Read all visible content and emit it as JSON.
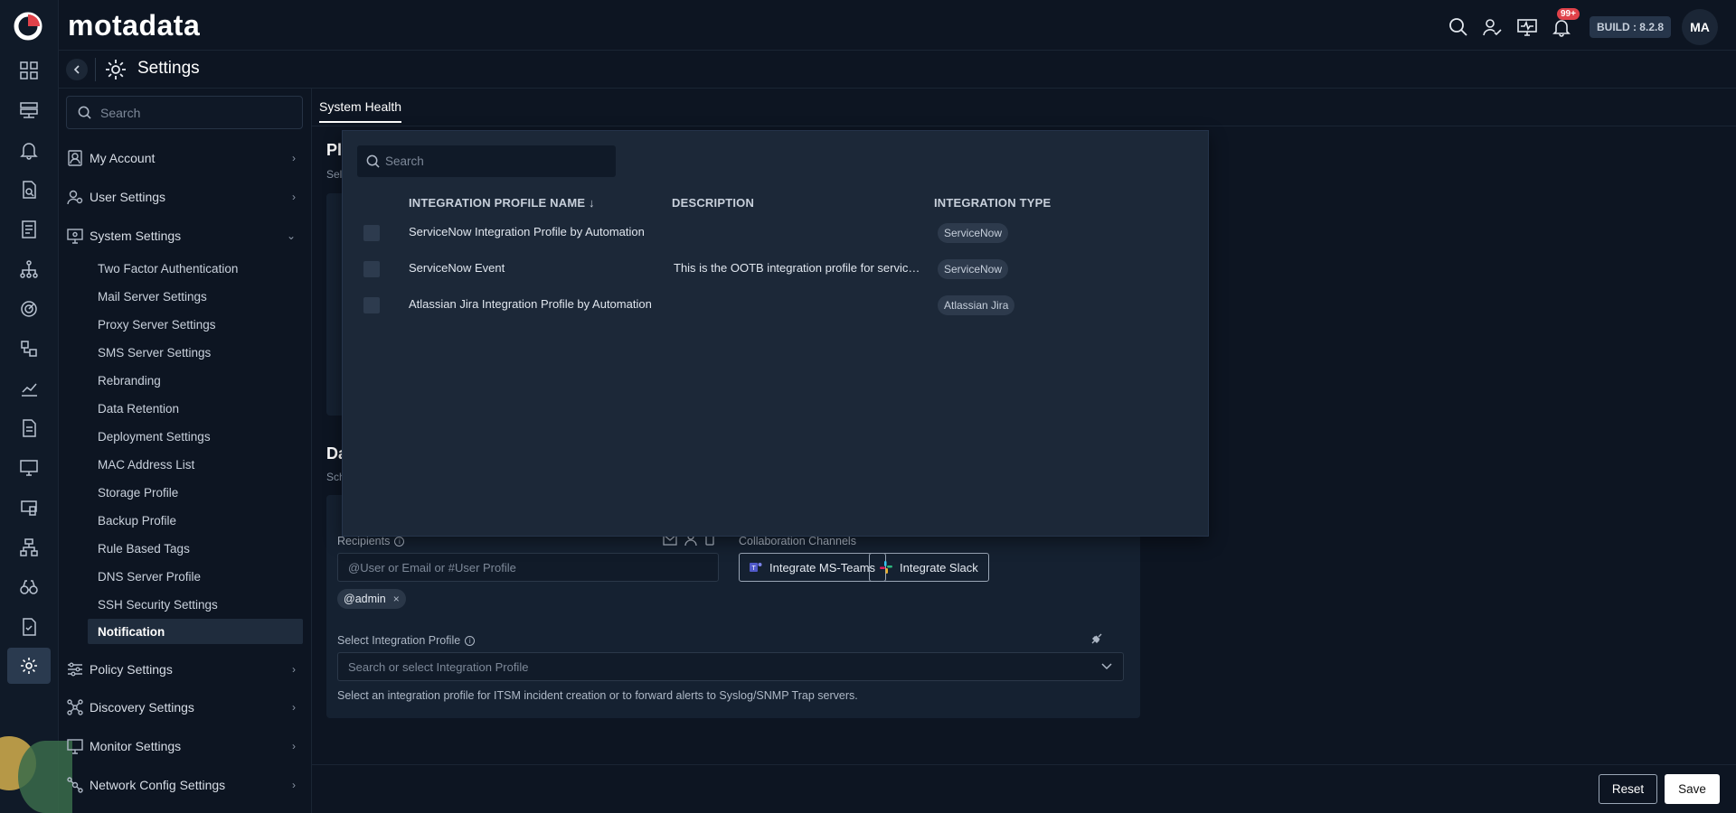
{
  "app": {
    "brand": "motadata",
    "build_label": "BUILD : 8.2.8",
    "avatar_initials": "MA",
    "notification_badge": "99+"
  },
  "page": {
    "title": "Settings"
  },
  "sidebar": {
    "search_placeholder": "Search",
    "groups": [
      {
        "label": "My Account",
        "icon": "user-badge-icon"
      },
      {
        "label": "User Settings",
        "icon": "user-gear-icon"
      },
      {
        "label": "System Settings",
        "icon": "monitor-gear-icon"
      },
      {
        "label": "Policy Settings",
        "icon": "sliders-icon"
      },
      {
        "label": "Discovery Settings",
        "icon": "network-icon"
      },
      {
        "label": "Monitor Settings",
        "icon": "monitor-icon"
      },
      {
        "label": "Network Config Settings",
        "icon": "network-config-icon"
      }
    ],
    "system_items": [
      "Two Factor Authentication",
      "Mail Server Settings",
      "Proxy Server Settings",
      "SMS Server Settings",
      "Rebranding",
      "Data Retention",
      "Deployment Settings",
      "MAC Address List",
      "Storage Profile",
      "Backup Profile",
      "Rule Based Tags",
      "DNS Server Profile",
      "SSH Security Settings",
      "Notification"
    ],
    "active_item": "Notification"
  },
  "main": {
    "tab": "System Health",
    "section1_title": "Pl",
    "section1_sub": "Sel",
    "section2_title": "Da",
    "section2_sub": "Sch",
    "recipients_label": "Recipients",
    "recipients_placeholder": "@User or Email or #User Profile",
    "recipient_chip": "@admin",
    "collab_label": "Collaboration Channels",
    "teams_button": "Integrate MS-Teams",
    "slack_button": "Integrate Slack",
    "integration_label": "Select Integration Profile",
    "integration_placeholder": "Search or select Integration Profile",
    "integration_help": "Select an integration profile for ITSM incident creation or to forward alerts to Syslog/SNMP Trap servers."
  },
  "dropdown": {
    "search_placeholder": "Search",
    "columns": [
      "INTEGRATION PROFILE NAME ↓",
      "DESCRIPTION",
      "INTEGRATION TYPE"
    ],
    "rows": [
      {
        "name": "ServiceNow Integration Profile by Automation",
        "description": "",
        "type": "ServiceNow"
      },
      {
        "name": "ServiceNow Event",
        "description": "This is the OOTB integration profile for service...",
        "type": "ServiceNow"
      },
      {
        "name": "Atlassian Jira Integration Profile by Automation",
        "description": "",
        "type": "Atlassian Jira"
      }
    ]
  },
  "footer": {
    "reset_label": "Reset",
    "save_label": "Save"
  }
}
